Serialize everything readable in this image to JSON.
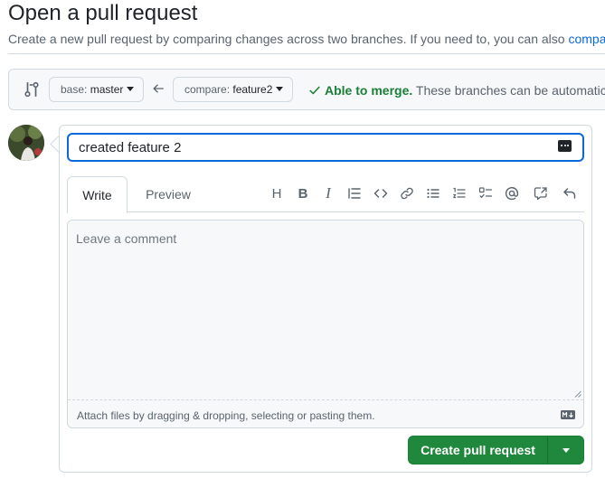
{
  "page": {
    "title": "Open a pull request",
    "subtitle_prefix": "Create a new pull request by comparing changes across two branches. If you need to, you can also ",
    "subtitle_link": "compare"
  },
  "range": {
    "base_prefix": "base: ",
    "base_branch": "master",
    "compare_prefix": "compare: ",
    "compare_branch": "feature2",
    "merge_status": "Able to merge.",
    "merge_description": "These branches can be automatically merged."
  },
  "form": {
    "title_value": "created feature 2",
    "tabs": [
      "Write",
      "Preview"
    ],
    "toolbar_icons": [
      "heading-icon",
      "bold-icon",
      "italic-icon",
      "quote-icon",
      "code-icon",
      "link-icon",
      "unordered-list-icon",
      "ordered-list-icon",
      "task-list-icon",
      "mention-icon",
      "reference-icon",
      "undo-icon"
    ],
    "comment_placeholder": "Leave a comment",
    "attach_hint": "Attach files by dragging & dropping, selecting or pasting them.",
    "submit_label": "Create pull request"
  },
  "colors": {
    "accent_blue": "#0969da",
    "merge_green": "#1a7f37",
    "button_green": "#1f883d"
  }
}
